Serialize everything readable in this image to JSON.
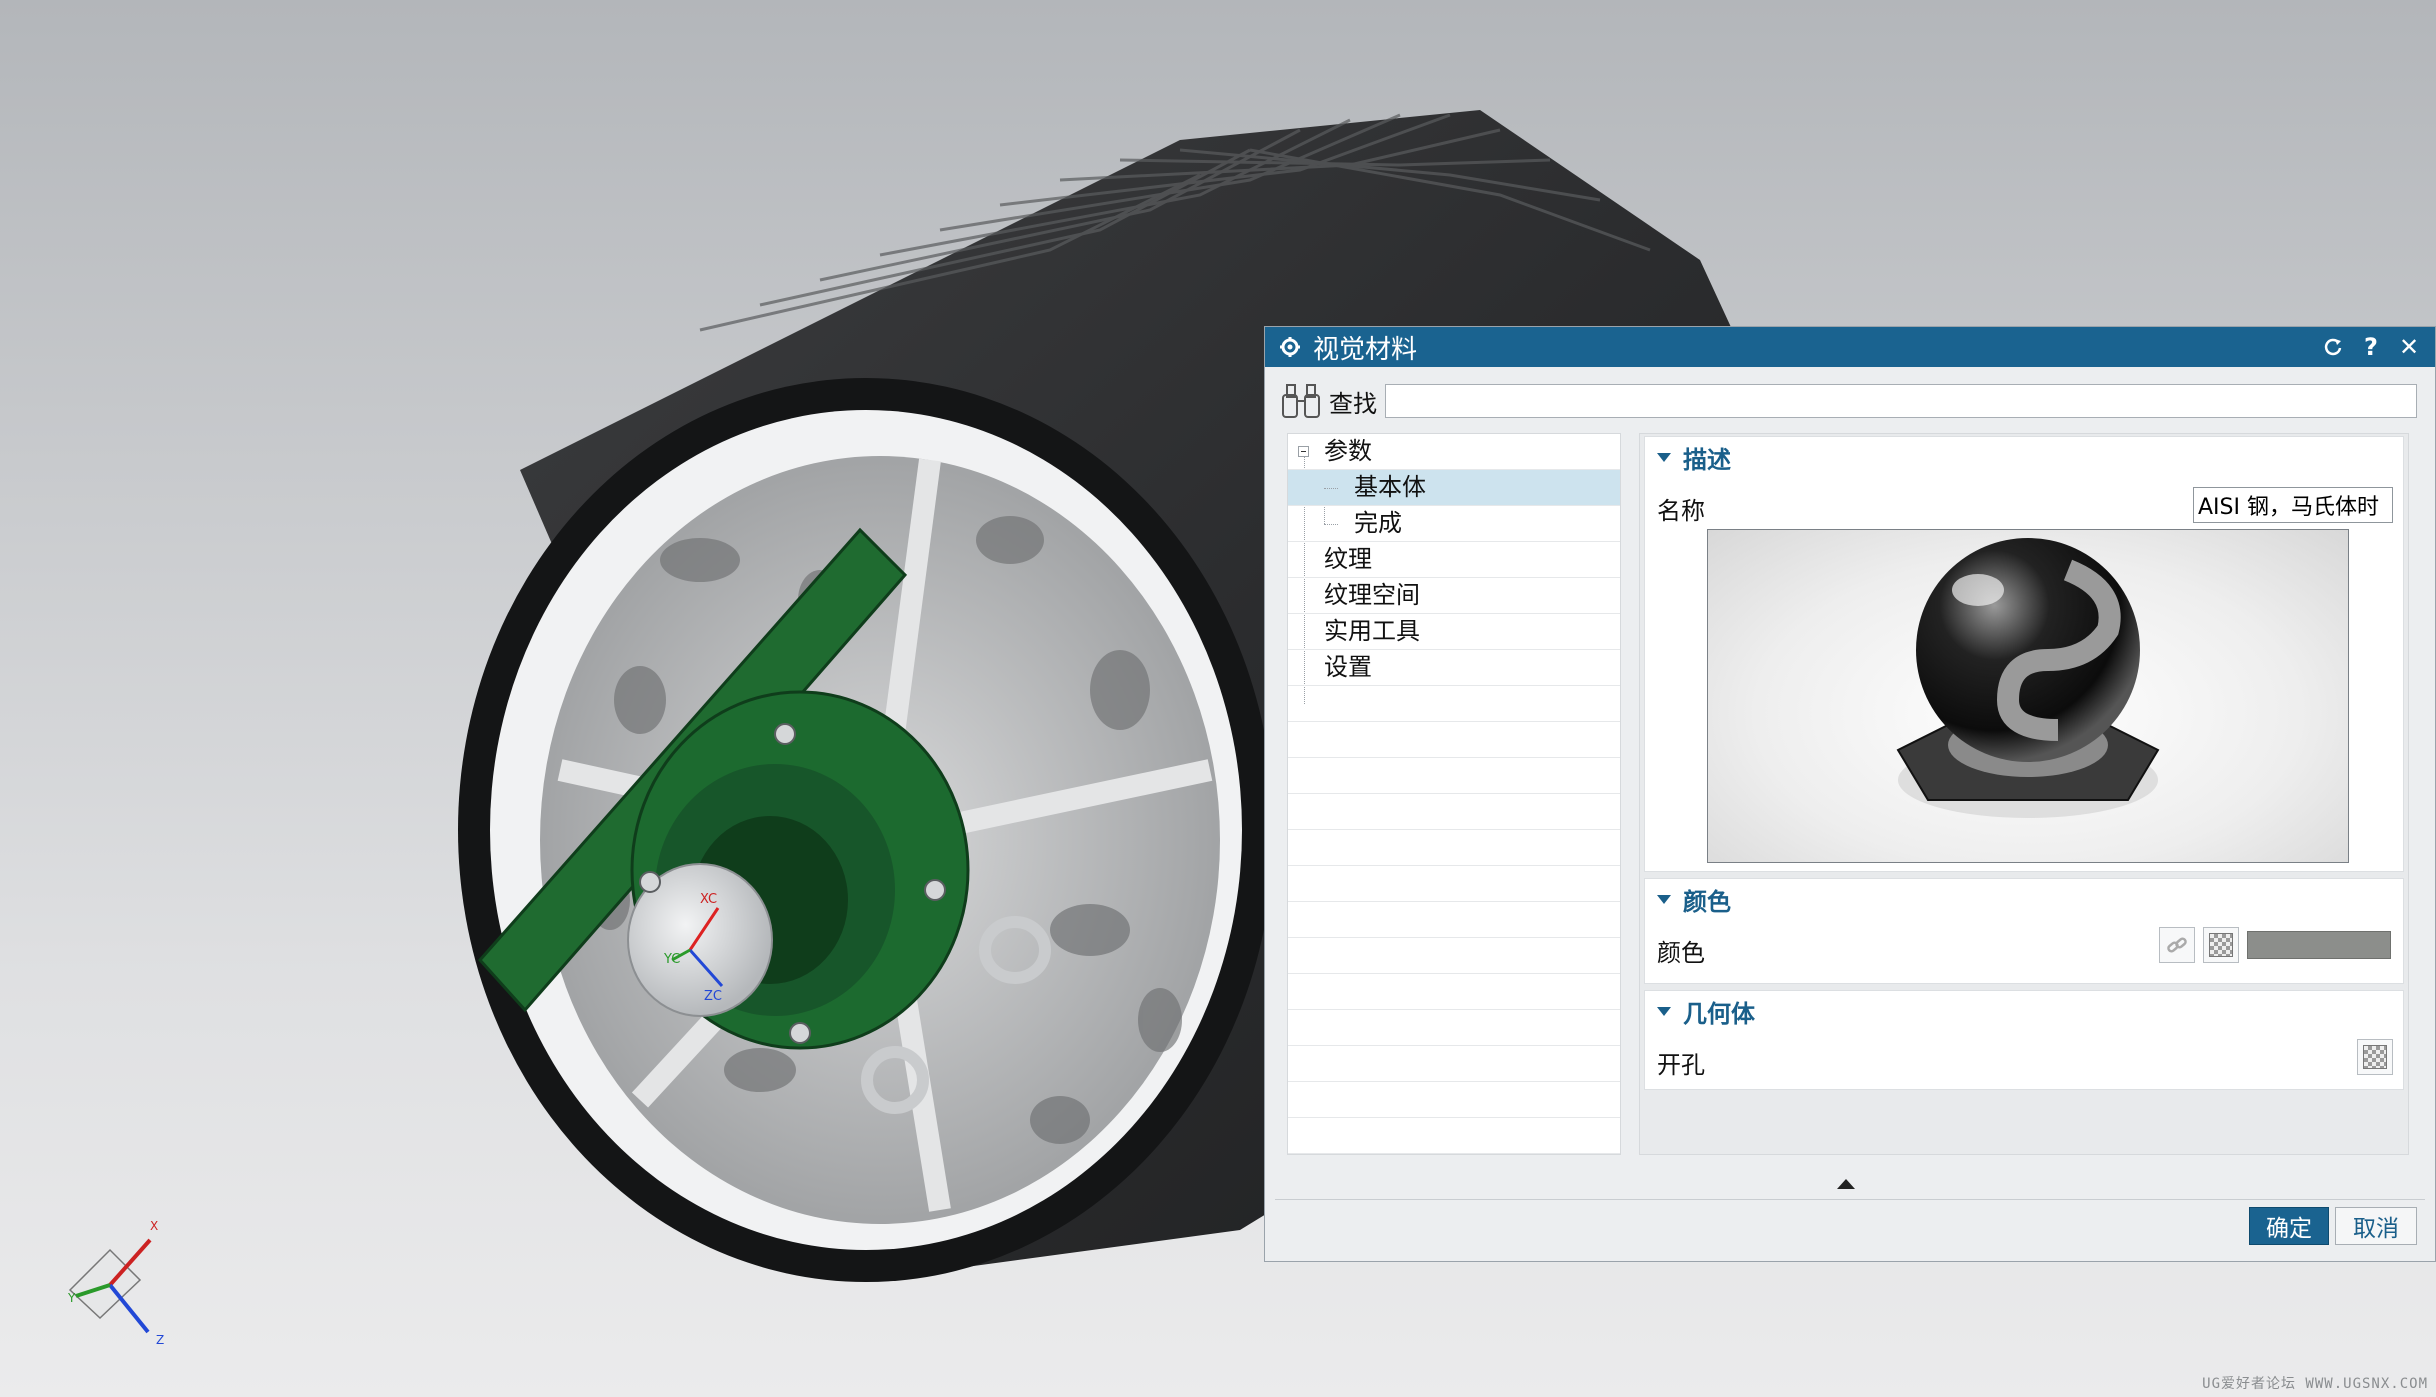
{
  "dialog": {
    "title": "视觉材料",
    "find_label": "查找",
    "find_value": "",
    "ok_label": "确定",
    "cancel_label": "取消"
  },
  "tree": {
    "items": [
      {
        "label": "参数",
        "level": 0,
        "expanded": true
      },
      {
        "label": "基本体",
        "level": 1,
        "selected": true
      },
      {
        "label": "完成",
        "level": 1
      },
      {
        "label": "纹理",
        "level": 0
      },
      {
        "label": "纹理空间",
        "level": 0
      },
      {
        "label": "实用工具",
        "level": 0
      },
      {
        "label": "设置",
        "level": 0
      }
    ]
  },
  "sections": {
    "description": {
      "header": "描述",
      "name_label": "名称",
      "name_value": "AISI 钢，马氏体时"
    },
    "color": {
      "header": "颜色",
      "color_label": "颜色",
      "swatch_color": "#8c8e8b"
    },
    "geometry": {
      "header": "几何体",
      "hole_label": "开孔"
    }
  },
  "viewport": {
    "axis_labels": {
      "x": "X",
      "y": "Y",
      "z": "Z",
      "xc": "XC",
      "yc": "YC",
      "zc": "ZC"
    },
    "watermark": "UG爱好者论坛 WWW.UGSNX.COM"
  },
  "colors": {
    "titlebar": "#1a6390",
    "accent_text": "#1a5f8a",
    "bracket_green": "#1f6b30",
    "roller_rubber": "#2f3032"
  },
  "icons": {
    "title": "gear-icon",
    "reset": "reset-icon",
    "help": "help-icon",
    "close": "close-icon",
    "find": "binoculars-icon",
    "link": "link-icon",
    "texture": "checker-icon"
  }
}
